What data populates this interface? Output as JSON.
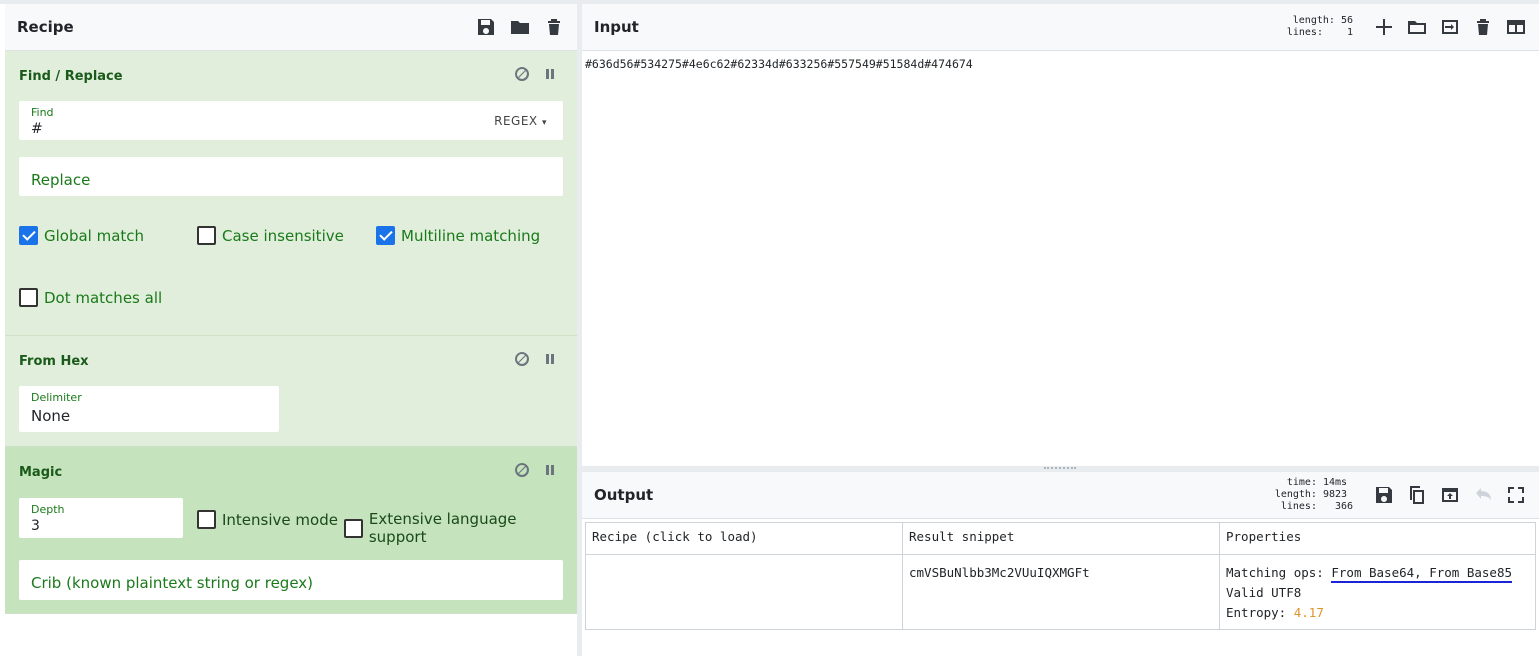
{
  "recipe": {
    "title": "Recipe",
    "find_replace": {
      "title": "Find / Replace",
      "find_label": "Find",
      "find_value": "#",
      "find_mode": "REGEX",
      "replace_placeholder": "Replace",
      "options": [
        {
          "label": "Global match",
          "checked": true
        },
        {
          "label": "Case insensitive",
          "checked": false
        },
        {
          "label": "Multiline matching",
          "checked": true
        },
        {
          "label": "Dot matches all",
          "checked": false
        }
      ]
    },
    "from_hex": {
      "title": "From Hex",
      "delimiter_label": "Delimiter",
      "delimiter_value": "None"
    },
    "magic": {
      "title": "Magic",
      "depth_label": "Depth",
      "depth_value": "3",
      "intensive_label": "Intensive mode",
      "extensive_label": "Extensive language support",
      "crib_placeholder": "Crib (known plaintext string or regex)"
    }
  },
  "input": {
    "title": "Input",
    "length_label": "length:",
    "length_value": "56",
    "lines_label": "lines:",
    "lines_value": "1",
    "text": "#636d56#534275#4e6c62#62334d#633256#557549#51584d#474674"
  },
  "output": {
    "title": "Output",
    "time_label": "time:",
    "time_value": "14ms",
    "length_label": "length:",
    "length_value": "9823",
    "lines_label": "lines:",
    "lines_value": "366",
    "columns": [
      "Recipe (click to load)",
      "Result snippet",
      "Properties"
    ],
    "row": {
      "recipe": "",
      "snippet": "cmVSBuNlbb3Mc2VUuIQXMGFt",
      "matching_label": "Matching ops:",
      "matching_ops": "From Base64, From Base85",
      "valid": "Valid UTF8",
      "entropy_label": "Entropy:",
      "entropy_value": "4.17"
    }
  }
}
